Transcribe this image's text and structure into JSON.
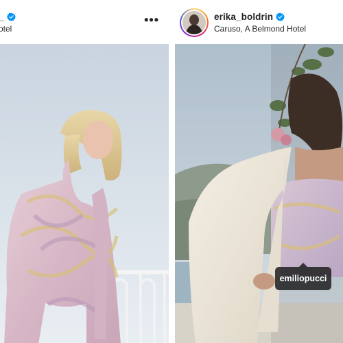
{
  "left_post": {
    "username_fragment": "_",
    "location_fragment": "otel",
    "more_label": "•••",
    "icons": [
      "verified-badge-icon",
      "more-options-icon"
    ]
  },
  "right_post": {
    "username": "erika_boldrin",
    "location": "Caruso, A Belmond Hotel",
    "tag_label": "emiliopucci",
    "icons": [
      "verified-badge-icon"
    ]
  },
  "colors": {
    "verified_blue": "#0095f6",
    "text": "#262626",
    "tag_bg": "#1e1e1e"
  }
}
